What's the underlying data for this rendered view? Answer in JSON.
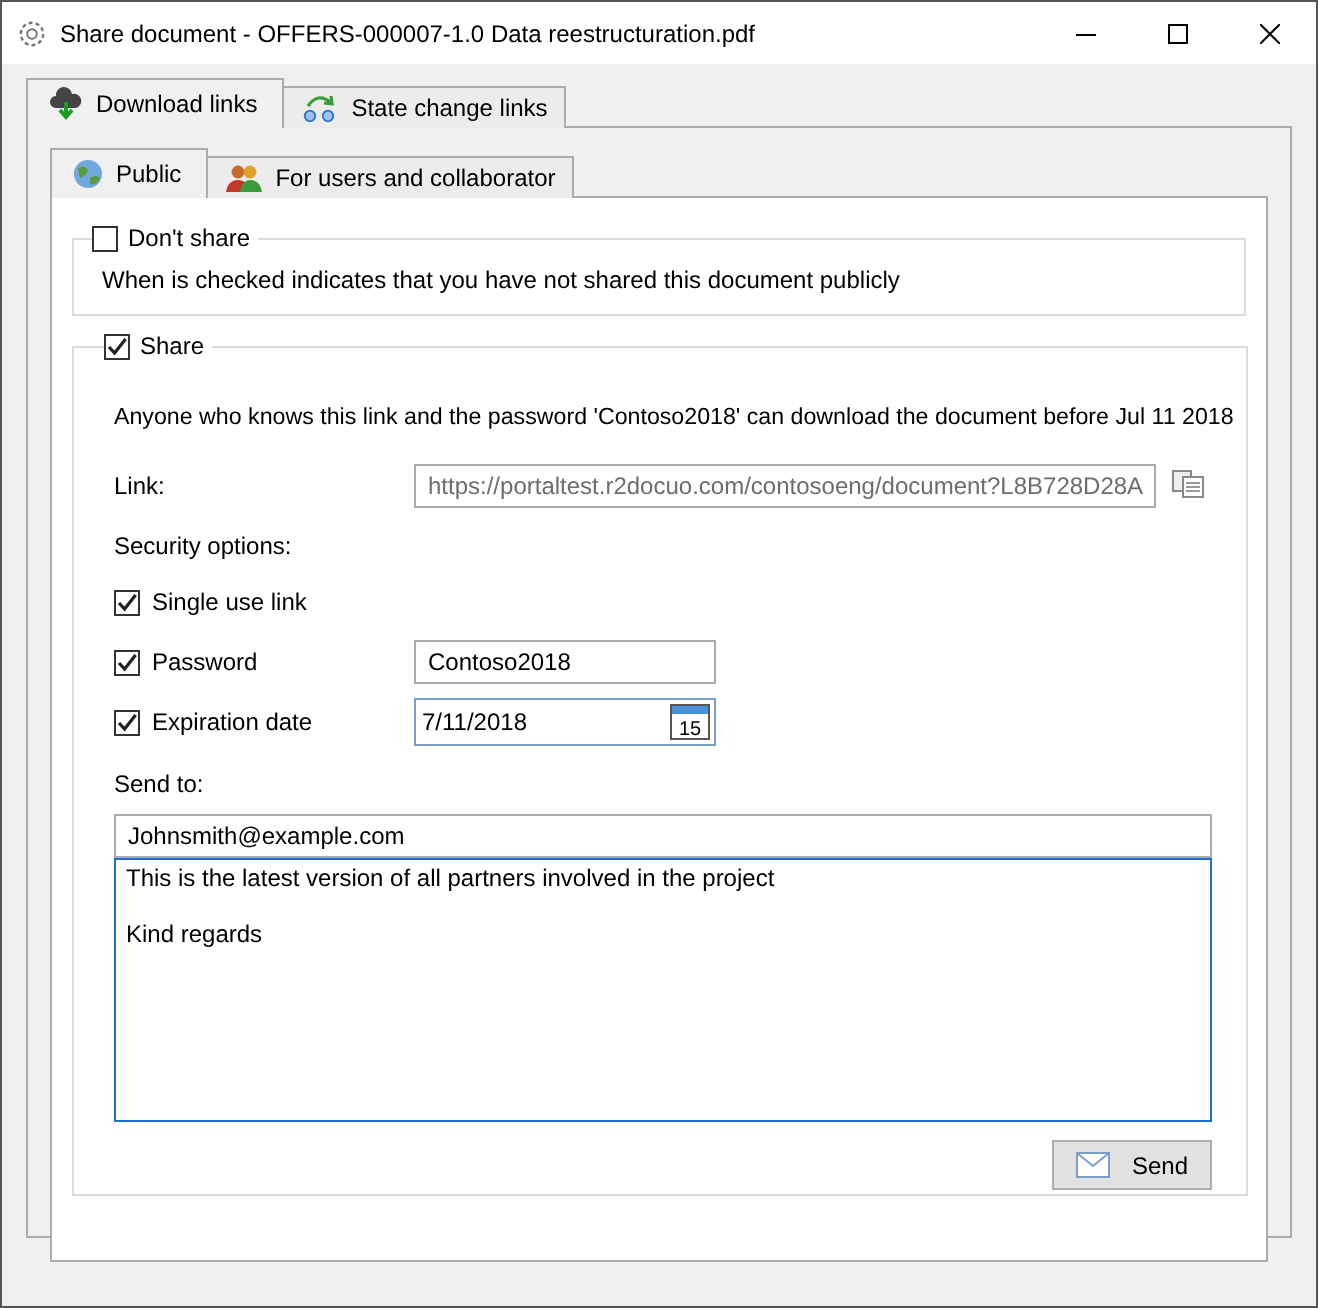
{
  "window": {
    "title": "Share document - OFFERS-000007-1.0 Data reestructuration.pdf"
  },
  "tabs": [
    {
      "label": "Download links",
      "selected": true
    },
    {
      "label": "State change links",
      "selected": false
    }
  ],
  "subtabs": [
    {
      "label": "Public",
      "selected": true
    },
    {
      "label": "For users and collaborator",
      "selected": false
    }
  ],
  "dont_share": {
    "label": "Don't share",
    "checked": false,
    "description": "When is checked indicates that you have not shared this document publicly"
  },
  "share": {
    "label": "Share",
    "checked": true,
    "description": "Anyone who knows this link and the password 'Contoso2018' can download the document before Jul 11 2018",
    "link_label": "Link:",
    "link": "https://portaltest.r2docuo.com/contosoeng/document?L8B728D28A",
    "security_label": "Security options:",
    "options": [
      {
        "kind": "check",
        "label": "Single use link",
        "checked": true
      },
      {
        "kind": "text",
        "label": "Password",
        "checked": true,
        "value": "Contoso2018"
      },
      {
        "kind": "date",
        "label": "Expiration date",
        "checked": true,
        "value": "7/11/2018",
        "calendar_day": "15"
      }
    ],
    "send_to_label": "Send to:",
    "recipient": "Johnsmith@example.com",
    "message": "This is the latest version of all partners involved in the project\n\nKind regards",
    "send_button": "Send"
  }
}
